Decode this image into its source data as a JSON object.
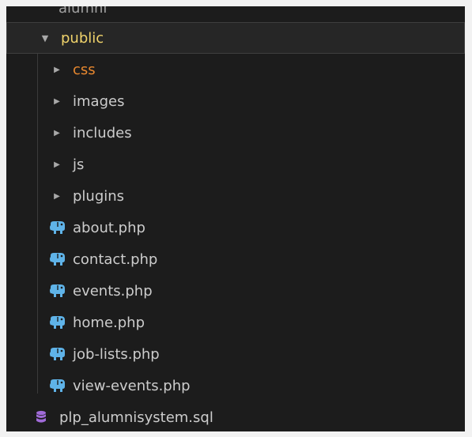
{
  "explorer": {
    "partial_item": "alumni",
    "public_folder": {
      "label": "public",
      "expanded": true
    },
    "subfolders": [
      {
        "label": "css",
        "color": "#e8882f"
      },
      {
        "label": "images"
      },
      {
        "label": "includes"
      },
      {
        "label": "js"
      },
      {
        "label": "plugins"
      }
    ],
    "php_files": [
      {
        "label": "about.php"
      },
      {
        "label": "contact.php"
      },
      {
        "label": "events.php"
      },
      {
        "label": "home.php"
      },
      {
        "label": "job-lists.php"
      },
      {
        "label": "view-events.php"
      }
    ],
    "sql_file": {
      "label": "plp_alumnisystem.sql"
    },
    "colors": {
      "background": "#1c1c1c",
      "text": "#cccccc",
      "public_label": "#f0d36b",
      "modified_folder": "#e8882f",
      "php_icon": "#5fb3e8",
      "db_icon": "#a06bd8"
    },
    "icons": {
      "php": "php-elephant-icon",
      "sql": "database-icon",
      "expanded": "chevron-down-icon",
      "collapsed": "chevron-right-icon"
    }
  }
}
